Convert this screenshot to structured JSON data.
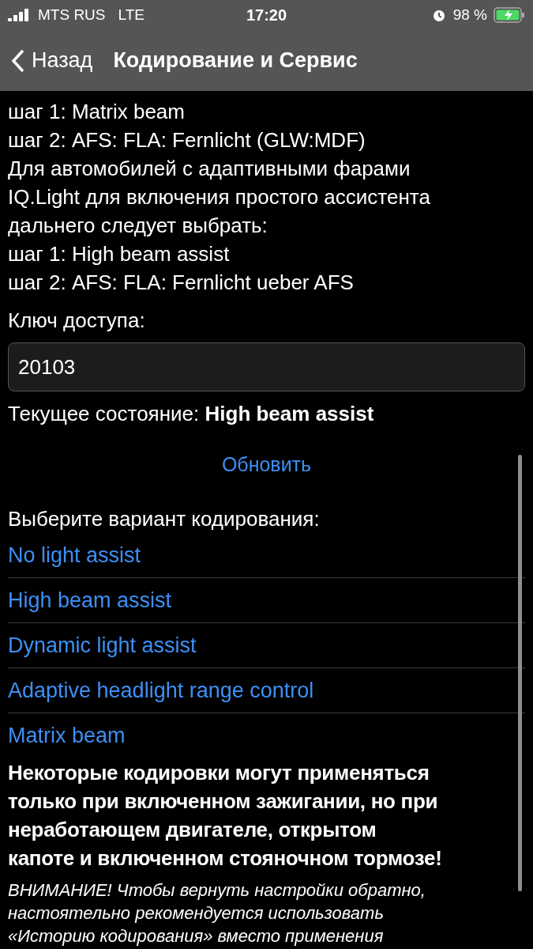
{
  "status_bar": {
    "carrier": "MTS RUS",
    "network": "LTE",
    "time": "17:20",
    "battery": "98 %"
  },
  "nav": {
    "back": "Назад",
    "title": "Кодирование и Сервис"
  },
  "description_lines": [
    "шаг 1: Matrix beam",
    "шаг 2: AFS: FLA: Fernlicht (GLW:MDF)",
    "Для автомобилей с адаптивными фарами",
    "IQ.Light для включения простого ассистента",
    "дальнего следует выбрать:",
    "шаг 1: High beam assist",
    "шаг 2: AFS: FLA: Fernlicht ueber AFS"
  ],
  "access_key": {
    "label": "Ключ доступа:",
    "value": "20103"
  },
  "current_state": {
    "label": "Текущее состояние:",
    "value": "High beam assist"
  },
  "refresh": "Обновить",
  "choose_label": "Выберите вариант кодирования:",
  "options": [
    "No light assist",
    "High beam assist",
    "Dynamic light assist",
    "Adaptive headlight range control",
    "Matrix beam"
  ],
  "warning_lines": [
    "Некоторые кодировки могут применяться",
    "только при включенном зажигании, но при",
    "неработающем двигателе, открытом",
    "капоте и включенном стояночном тормозе!"
  ],
  "note_lines": [
    "ВНИМАНИЕ! Чтобы вернуть настройки обратно,",
    "настоятельно рекомендуется использовать",
    "«Историю кодирования» вместо применения"
  ]
}
